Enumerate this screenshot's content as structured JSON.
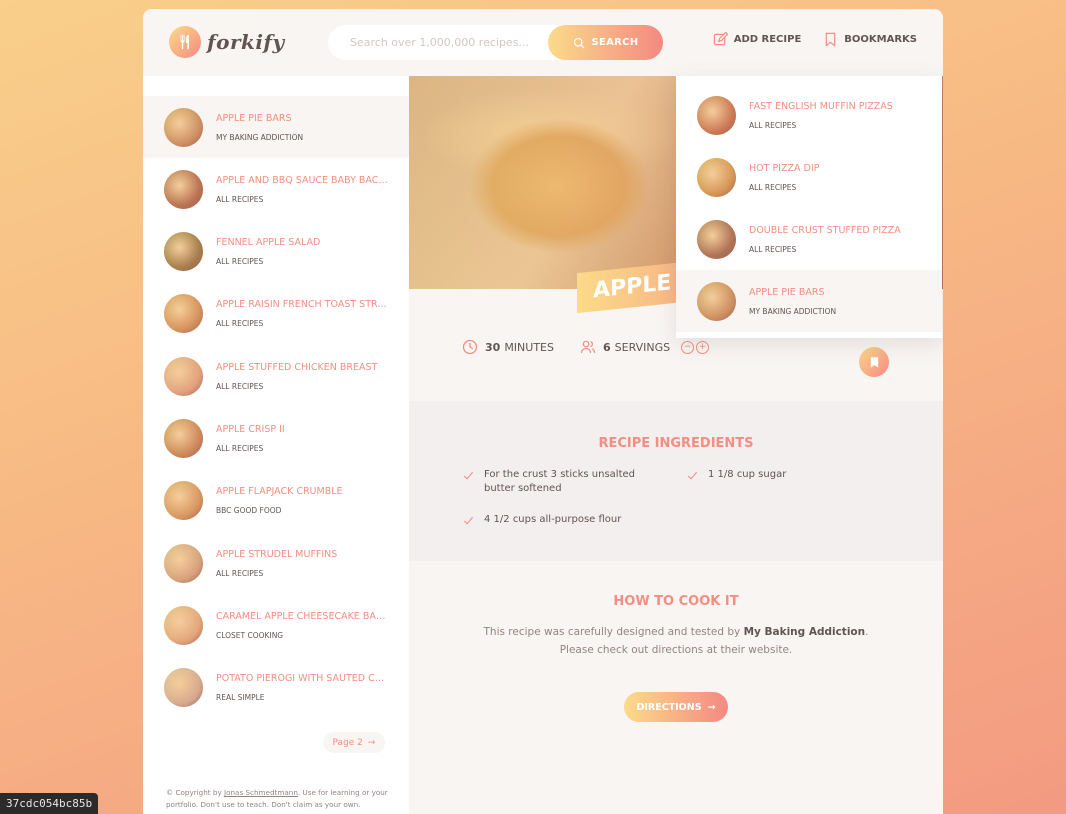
{
  "app": {
    "logo_text": "forkify"
  },
  "header": {
    "search_placeholder": "Search over 1,000,000 recipes...",
    "search_button": "SEARCH",
    "add_recipe": "ADD RECIPE",
    "bookmarks": "BOOKMARKS"
  },
  "results": [
    {
      "title": "APPLE PIE BARS",
      "publisher": "MY BAKING ADDICTION",
      "active": true,
      "thumb_color": "#b9874f"
    },
    {
      "title": "APPLE AND BBQ SAUCE BABY BACK RIBS",
      "publisher": "ALL RECIPES",
      "thumb_color": "#9b5a3a"
    },
    {
      "title": "FENNEL APPLE SALAD",
      "publisher": "ALL RECIPES",
      "thumb_color": "#7d6a2e"
    },
    {
      "title": "APPLE RAISIN FRENCH TOAST STRATA",
      "publisher": "ALL RECIPES",
      "thumb_color": "#c68a48"
    },
    {
      "title": "APPLE STUFFED CHICKEN BREAST",
      "publisher": "ALL RECIPES",
      "thumb_color": "#d7a07a"
    },
    {
      "title": "APPLE CRISP II",
      "publisher": "ALL RECIPES",
      "thumb_color": "#b97c45"
    },
    {
      "title": "APPLE FLAPJACK CRUMBLE",
      "publisher": "BBC GOOD FOOD",
      "thumb_color": "#c9924f"
    },
    {
      "title": "APPLE STRUDEL MUFFINS",
      "publisher": "ALL RECIPES",
      "thumb_color": "#c9a27a"
    },
    {
      "title": "CARAMEL APPLE CHEESECAKE BARS",
      "publisher": "CLOSET COOKING",
      "thumb_color": "#d9a977"
    },
    {
      "title": "POTATO PIEROGI WITH SAUTED CABBAGE",
      "publisher": "REAL SIMPLE",
      "thumb_color": "#c7ae94"
    }
  ],
  "pagination": {
    "next": "Page 2"
  },
  "copyright": {
    "prefix": "© Copyright by ",
    "author": "Jonas Schmedtmann",
    "suffix": ". Use for learning or your portfolio. Don't use to teach. Don't claim as your own."
  },
  "recipe": {
    "title": "APPLE PIE BARS",
    "cooking_time": "30",
    "minutes_label": "MINUTES",
    "servings": "6",
    "servings_label": "SERVINGS",
    "ingredients_heading": "RECIPE INGREDIENTS",
    "ingredients": [
      "For the crust 3 sticks unsalted butter softened",
      "1 1/8 cup sugar",
      "4 1/2 cups all-purpose flour"
    ],
    "cook_heading": "HOW TO COOK IT",
    "cook_text_1": "This recipe was carefully designed and tested by ",
    "publisher": "My Baking Addiction",
    "cook_text_2": ". Please check out directions at their website.",
    "directions_button": "DIRECTIONS"
  },
  "bookmarks": [
    {
      "title": "FAST ENGLISH MUFFIN PIZZAS",
      "publisher": "ALL RECIPES",
      "thumb_color": "#b6643e"
    },
    {
      "title": "HOT PIZZA DIP",
      "publisher": "ALL RECIPES",
      "thumb_color": "#c6913e"
    },
    {
      "title": "DOUBLE CRUST STUFFED PIZZA",
      "publisher": "ALL RECIPES",
      "thumb_color": "#8a5a3e"
    },
    {
      "title": "APPLE PIE BARS",
      "publisher": "MY BAKING ADDICTION",
      "active": true,
      "thumb_color": "#b9874f"
    }
  ],
  "debug_tag": "37cdc054bc85b",
  "colors": {
    "accent": "#f38e82",
    "grad_start": "#fbdb89",
    "grad_end": "#f48982",
    "text": "#615551"
  }
}
